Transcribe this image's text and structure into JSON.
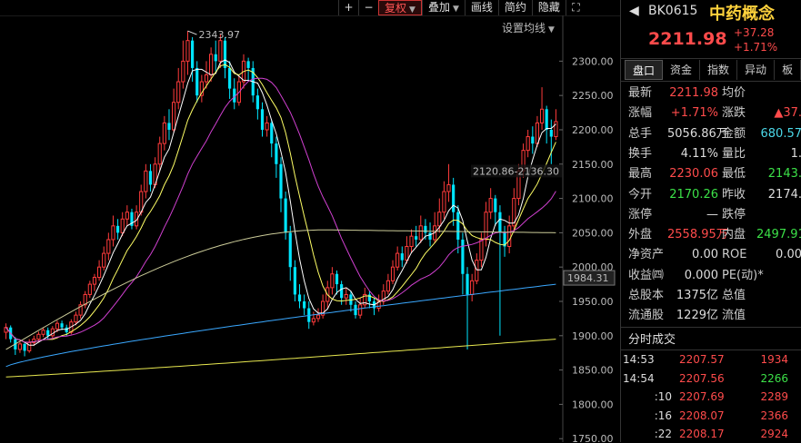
{
  "toolbar": {
    "buttons": [
      {
        "label": "+",
        "type": "sq"
      },
      {
        "label": "−",
        "type": "sq"
      },
      {
        "label": "复权",
        "caret": true,
        "active": true
      },
      {
        "label": "叠加",
        "caret": true
      },
      {
        "label": "画线"
      },
      {
        "label": "简约"
      },
      {
        "label": "隐藏"
      },
      {
        "label": "⛶",
        "type": "sq"
      }
    ]
  },
  "ma_settings_label": "设置均线",
  "chart_data": {
    "type": "candlestick",
    "y_ticks": [
      "2300.00",
      "2250.00",
      "2200.00",
      "2150.00",
      "2100.00",
      "2050.00",
      "2000.00",
      "1950.00",
      "1900.00",
      "1850.00",
      "1800.00",
      "1750.00"
    ],
    "ylim": [
      1745,
      2360
    ],
    "current_price_tag": "1984.31",
    "high_annotation": "2343.97",
    "range_annotation": "2120.86-2136.30",
    "candles": [
      [
        1905,
        1912,
        1895,
        1918
      ],
      [
        1912,
        1895,
        1890,
        1915
      ],
      [
        1895,
        1880,
        1872,
        1898
      ],
      [
        1880,
        1888,
        1875,
        1892
      ],
      [
        1888,
        1878,
        1870,
        1890
      ],
      [
        1878,
        1890,
        1875,
        1895
      ],
      [
        1890,
        1895,
        1885,
        1900
      ],
      [
        1895,
        1902,
        1890,
        1906
      ],
      [
        1902,
        1908,
        1898,
        1912
      ],
      [
        1908,
        1900,
        1895,
        1912
      ],
      [
        1900,
        1910,
        1896,
        1914
      ],
      [
        1910,
        1918,
        1905,
        1922
      ],
      [
        1918,
        1912,
        1908,
        1922
      ],
      [
        1912,
        1905,
        1900,
        1916
      ],
      [
        1905,
        1920,
        1902,
        1924
      ],
      [
        1920,
        1930,
        1915,
        1935
      ],
      [
        1930,
        1945,
        1925,
        1950
      ],
      [
        1945,
        1960,
        1940,
        1965
      ],
      [
        1960,
        1975,
        1955,
        1980
      ],
      [
        1975,
        1985,
        1965,
        1990
      ],
      [
        1985,
        2000,
        1980,
        2010
      ],
      [
        2000,
        2020,
        1995,
        2030
      ],
      [
        2020,
        2040,
        2010,
        2050
      ],
      [
        2040,
        2060,
        2030,
        2075
      ],
      [
        2060,
        2050,
        2040,
        2070
      ],
      [
        2050,
        2070,
        2045,
        2080
      ],
      [
        2070,
        2080,
        2060,
        2090
      ],
      [
        2080,
        2060,
        2055,
        2085
      ],
      [
        2060,
        2080,
        2055,
        2090
      ],
      [
        2080,
        2110,
        2075,
        2120
      ],
      [
        2110,
        2140,
        2100,
        2150
      ],
      [
        2140,
        2120,
        2110,
        2150
      ],
      [
        2120,
        2150,
        2115,
        2160
      ],
      [
        2150,
        2180,
        2140,
        2190
      ],
      [
        2180,
        2210,
        2170,
        2220
      ],
      [
        2210,
        2200,
        2185,
        2230
      ],
      [
        2200,
        2240,
        2195,
        2260
      ],
      [
        2240,
        2270,
        2230,
        2290
      ],
      [
        2270,
        2300,
        2260,
        2330
      ],
      [
        2300,
        2330,
        2280,
        2344
      ],
      [
        2330,
        2290,
        2270,
        2335
      ],
      [
        2290,
        2250,
        2240,
        2300
      ],
      [
        2250,
        2270,
        2240,
        2280
      ],
      [
        2270,
        2280,
        2260,
        2300
      ],
      [
        2280,
        2310,
        2270,
        2320
      ],
      [
        2310,
        2300,
        2285,
        2330
      ],
      [
        2300,
        2330,
        2290,
        2340
      ],
      [
        2330,
        2290,
        2275,
        2335
      ],
      [
        2290,
        2260,
        2245,
        2300
      ],
      [
        2260,
        2240,
        2230,
        2275
      ],
      [
        2240,
        2270,
        2235,
        2280
      ],
      [
        2270,
        2300,
        2260,
        2310
      ],
      [
        2300,
        2290,
        2270,
        2305
      ],
      [
        2290,
        2250,
        2240,
        2300
      ],
      [
        2250,
        2230,
        2215,
        2260
      ],
      [
        2230,
        2200,
        2190,
        2240
      ],
      [
        2200,
        2210,
        2190,
        2220
      ],
      [
        2210,
        2180,
        2160,
        2215
      ],
      [
        2180,
        2150,
        2130,
        2190
      ],
      [
        2150,
        2100,
        2080,
        2160
      ],
      [
        2100,
        2050,
        2040,
        2110
      ],
      [
        2050,
        2000,
        1980,
        2060
      ],
      [
        2000,
        1960,
        1950,
        2010
      ],
      [
        1960,
        1950,
        1940,
        1975
      ],
      [
        1950,
        1940,
        1930,
        1960
      ],
      [
        1940,
        1920,
        1910,
        1950
      ],
      [
        1920,
        1925,
        1915,
        1935
      ],
      [
        1925,
        1930,
        1920,
        1940
      ],
      [
        1930,
        1950,
        1925,
        1960
      ],
      [
        1950,
        1970,
        1940,
        1980
      ],
      [
        1970,
        1990,
        1960,
        2000
      ],
      [
        1990,
        1975,
        1960,
        1995
      ],
      [
        1975,
        1955,
        1945,
        1980
      ],
      [
        1955,
        1960,
        1945,
        1970
      ],
      [
        1960,
        1945,
        1935,
        1965
      ],
      [
        1945,
        1930,
        1925,
        1950
      ],
      [
        1930,
        1945,
        1925,
        1955
      ],
      [
        1945,
        1960,
        1940,
        1970
      ],
      [
        1960,
        1950,
        1940,
        1965
      ],
      [
        1950,
        1940,
        1930,
        1955
      ],
      [
        1940,
        1950,
        1935,
        1960
      ],
      [
        1950,
        1965,
        1945,
        1975
      ],
      [
        1965,
        1980,
        1960,
        1990
      ],
      [
        1980,
        2000,
        1975,
        2010
      ],
      [
        2000,
        2020,
        1995,
        2030
      ],
      [
        2020,
        2010,
        2000,
        2030
      ],
      [
        2010,
        2030,
        2005,
        2045
      ],
      [
        2030,
        2045,
        2020,
        2055
      ],
      [
        2045,
        2040,
        2030,
        2060
      ],
      [
        2040,
        2060,
        2035,
        2075
      ],
      [
        2060,
        2050,
        2040,
        2070
      ],
      [
        2050,
        2040,
        2030,
        2065
      ],
      [
        2040,
        2060,
        2035,
        2080
      ],
      [
        2060,
        2080,
        2050,
        2100
      ],
      [
        2080,
        2110,
        2070,
        2125
      ],
      [
        2110,
        2120,
        2095,
        2150
      ],
      [
        2120,
        2080,
        2060,
        2130
      ],
      [
        2080,
        2040,
        2020,
        2090
      ],
      [
        2040,
        1990,
        1960,
        2050
      ],
      [
        1990,
        1960,
        1880,
        2000
      ],
      [
        1960,
        1980,
        1950,
        1990
      ],
      [
        1980,
        2010,
        1975,
        2020
      ],
      [
        2010,
        2040,
        2000,
        2050
      ],
      [
        2040,
        2080,
        2030,
        2095
      ],
      [
        2080,
        2100,
        2070,
        2115
      ],
      [
        2100,
        2080,
        2060,
        2105
      ],
      [
        2080,
        2050,
        1900,
        2090
      ],
      [
        2050,
        2030,
        2015,
        2060
      ],
      [
        2030,
        2060,
        2020,
        2075
      ],
      [
        2060,
        2100,
        2050,
        2115
      ],
      [
        2100,
        2140,
        2090,
        2150
      ],
      [
        2140,
        2170,
        2130,
        2180
      ],
      [
        2170,
        2190,
        2160,
        2200
      ],
      [
        2190,
        2180,
        2165,
        2205
      ],
      [
        2180,
        2210,
        2175,
        2220
      ],
      [
        2210,
        2230,
        2200,
        2262
      ],
      [
        2230,
        2200,
        2180,
        2235
      ],
      [
        2200,
        2190,
        2150,
        2215
      ],
      [
        2190,
        2212,
        2185,
        2230
      ]
    ]
  },
  "stock": {
    "code": "BK0615",
    "name": "中药概念",
    "price": "2211.98",
    "change": "+37.28",
    "change_pct": "+1.71%"
  },
  "tabs": [
    "盘口",
    "资金",
    "指数",
    "异动",
    "板"
  ],
  "quote_rows": [
    [
      {
        "l": "最新",
        "v": "2211.98",
        "c": "red"
      },
      {
        "l": "均价",
        "v": "",
        "c": "white"
      }
    ],
    [
      {
        "l": "涨幅",
        "v": "+1.71%",
        "c": "red"
      },
      {
        "l": "涨跌",
        "v": "▲37.",
        "c": "red"
      }
    ],
    [
      {
        "l": "总手",
        "v": "5056.86万",
        "c": "white"
      },
      {
        "l": "金额",
        "v": "680.57",
        "c": "cyan"
      }
    ],
    [
      {
        "l": "换手",
        "v": "4.11%",
        "c": "white"
      },
      {
        "l": "量比",
        "v": "1.",
        "c": "white"
      }
    ],
    [
      {
        "l": "最高",
        "v": "2230.06",
        "c": "red"
      },
      {
        "l": "最低",
        "v": "2143.",
        "c": "green"
      }
    ],
    [
      {
        "l": "今开",
        "v": "2170.26",
        "c": "green"
      },
      {
        "l": "昨收",
        "v": "2174.",
        "c": "white"
      }
    ],
    [
      {
        "l": "涨停",
        "v": "—",
        "c": "white"
      },
      {
        "l": "跌停",
        "v": "",
        "c": "white"
      }
    ],
    [
      {
        "l": "外盘",
        "v": "2558.95万",
        "c": "red"
      },
      {
        "l": "内盘",
        "v": "2497.91",
        "c": "green"
      }
    ],
    [
      {
        "l": "净资产",
        "v": "0.00",
        "c": "white"
      },
      {
        "l": "ROE",
        "v": "0.00",
        "c": "white"
      }
    ],
    [
      {
        "l": "收益㈣",
        "v": "0.000",
        "c": "white"
      },
      {
        "l": "PE(动)*",
        "v": "",
        "c": "white"
      }
    ],
    [
      {
        "l": "总股本",
        "v": "1375亿",
        "c": "white"
      },
      {
        "l": "总值",
        "v": "",
        "c": "white"
      }
    ],
    [
      {
        "l": "流通股",
        "v": "1229亿",
        "c": "white"
      },
      {
        "l": "流值",
        "v": "",
        "c": "white"
      }
    ]
  ],
  "trades_title": "分时成交",
  "trades": [
    {
      "time": "14:53",
      "price": "2207.57",
      "vol": "1934",
      "vc": "red"
    },
    {
      "time": "14:54",
      "price": "2207.56",
      "vol": "2266",
      "vc": "green"
    },
    {
      "time": ":10",
      "price": "2207.69",
      "vol": "2289",
      "vc": "red"
    },
    {
      "time": ":16",
      "price": "2208.07",
      "vol": "2366",
      "vc": "red"
    },
    {
      "time": ":22",
      "price": "2208.17",
      "vol": "2924",
      "vc": "red"
    }
  ]
}
